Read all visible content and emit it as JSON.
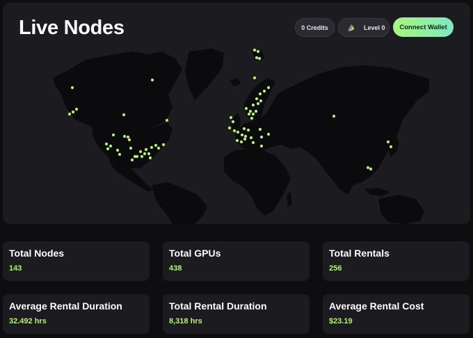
{
  "header": {
    "title": "Live Nodes",
    "credits_label": "0 Credits",
    "level_label": "Level 0",
    "connect_label": "Connect Wallet"
  },
  "map": {
    "land_color": "#0b0b0d",
    "node_color": "#b6f36a"
  },
  "stats": [
    {
      "label": "Total Nodes",
      "value": "143"
    },
    {
      "label": "Total GPUs",
      "value": "438"
    },
    {
      "label": "Total Rentals",
      "value": "256"
    },
    {
      "label": "Average Rental Duration",
      "value": "32.492 hrs"
    },
    {
      "label": "Total Rental Duration",
      "value": "8,318 hrs"
    },
    {
      "label": "Average Rental Cost",
      "value": "$23.19"
    }
  ]
}
